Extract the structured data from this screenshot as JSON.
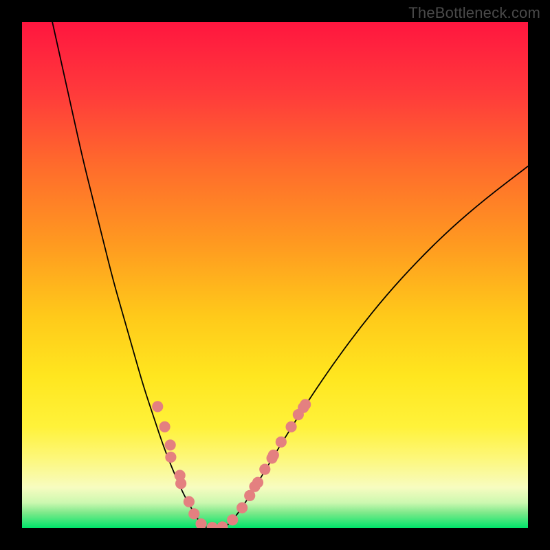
{
  "watermark": "TheBottleneck.com",
  "gradient": {
    "stops": [
      {
        "offset": "0%",
        "color": "#ff163f"
      },
      {
        "offset": "14%",
        "color": "#ff3a3b"
      },
      {
        "offset": "28%",
        "color": "#ff6a2c"
      },
      {
        "offset": "44%",
        "color": "#ff9a20"
      },
      {
        "offset": "58%",
        "color": "#ffc91a"
      },
      {
        "offset": "70%",
        "color": "#ffe61f"
      },
      {
        "offset": "80%",
        "color": "#fff23a"
      },
      {
        "offset": "86%",
        "color": "#fdf778"
      },
      {
        "offset": "92%",
        "color": "#f7fcc0"
      },
      {
        "offset": "95%",
        "color": "#ccf8b0"
      },
      {
        "offset": "97%",
        "color": "#7de98a"
      },
      {
        "offset": "100%",
        "color": "#00e46a"
      }
    ]
  },
  "chart_data": {
    "type": "line",
    "title": "",
    "xlabel": "",
    "ylabel": "",
    "xlim": [
      0,
      1000
    ],
    "ylim": [
      0,
      1000
    ],
    "note": "x,y in plot-area pixel coords; y=0 is top, y=1000 is bottom edge. Curve is a V-shaped bottleneck curve.",
    "series": [
      {
        "name": "left-branch",
        "x": [
          60,
          80,
          100,
          120,
          140,
          160,
          180,
          200,
          220,
          240,
          260,
          280,
          300,
          320,
          340,
          355
        ],
        "y": [
          0,
          90,
          180,
          270,
          350,
          430,
          510,
          580,
          650,
          720,
          780,
          840,
          890,
          935,
          970,
          995
        ]
      },
      {
        "name": "valley",
        "x": [
          355,
          365,
          375,
          385,
          395,
          405
        ],
        "y": [
          995,
          999,
          1000,
          1000,
          999,
          996
        ]
      },
      {
        "name": "right-branch",
        "x": [
          405,
          420,
          440,
          465,
          495,
          530,
          570,
          615,
          665,
          720,
          780,
          845,
          915,
          1000
        ],
        "y": [
          996,
          980,
          952,
          912,
          862,
          805,
          742,
          676,
          608,
          540,
          474,
          410,
          350,
          285
        ]
      }
    ],
    "dots": {
      "color": "#e48080",
      "radius": 11,
      "points": [
        {
          "x": 268,
          "y": 760
        },
        {
          "x": 282,
          "y": 800
        },
        {
          "x": 293,
          "y": 836
        },
        {
          "x": 294,
          "y": 860
        },
        {
          "x": 312,
          "y": 896
        },
        {
          "x": 314,
          "y": 912
        },
        {
          "x": 330,
          "y": 948
        },
        {
          "x": 340,
          "y": 972
        },
        {
          "x": 354,
          "y": 992
        },
        {
          "x": 376,
          "y": 999
        },
        {
          "x": 396,
          "y": 998
        },
        {
          "x": 416,
          "y": 984
        },
        {
          "x": 435,
          "y": 960
        },
        {
          "x": 450,
          "y": 936
        },
        {
          "x": 460,
          "y": 918
        },
        {
          "x": 466,
          "y": 910
        },
        {
          "x": 480,
          "y": 884
        },
        {
          "x": 494,
          "y": 862
        },
        {
          "x": 497,
          "y": 856
        },
        {
          "x": 512,
          "y": 830
        },
        {
          "x": 532,
          "y": 800
        },
        {
          "x": 546,
          "y": 776
        },
        {
          "x": 556,
          "y": 762
        },
        {
          "x": 560,
          "y": 756
        }
      ]
    }
  }
}
